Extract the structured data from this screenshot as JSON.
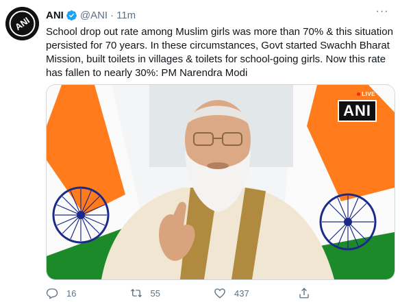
{
  "tweet": {
    "author_name": "ANI",
    "handle": "@ANI",
    "separator": "·",
    "time": "11m",
    "text": "School drop out rate among Muslim girls was more than 70% & this situation persisted for 70 years. In these circumstances, Govt started Swachh Bharat Mission, built toilets in villages & toilets for school-going girls. Now this rate has fallen to nearly 30%: PM Narendra Modi",
    "more_label": "···"
  },
  "media": {
    "live_label": "LIVE",
    "bug_label": "ANI"
  },
  "actions": {
    "replies": "16",
    "retweets": "55",
    "likes": "437"
  },
  "colors": {
    "text": "#0f1419",
    "secondary": "#5b7083",
    "verified": "#1da1f2",
    "saffron": "#ff7b1c",
    "green": "#138808",
    "chakra": "#1a2a8a"
  },
  "icons": [
    "ani-avatar-logo",
    "verified-badge-icon",
    "more-icon",
    "reply-icon",
    "retweet-icon",
    "like-icon",
    "share-icon"
  ]
}
